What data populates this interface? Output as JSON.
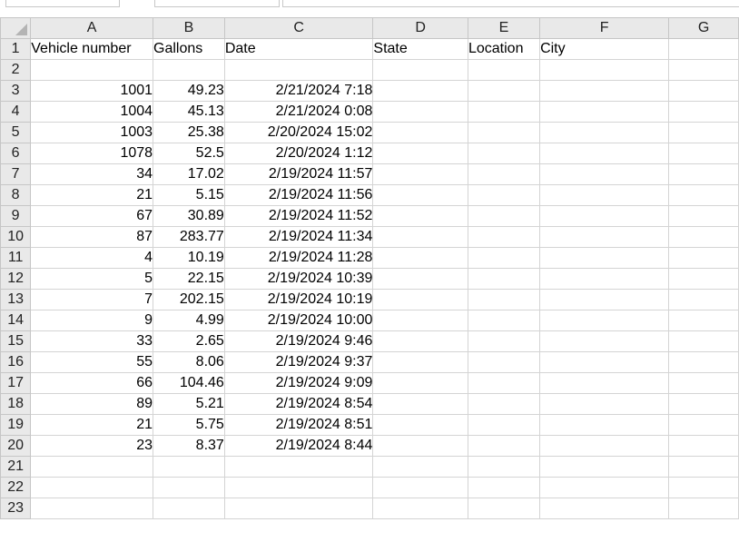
{
  "columns": [
    "A",
    "B",
    "C",
    "D",
    "E",
    "F",
    "G"
  ],
  "header_row": [
    "Vehicle number",
    "Gallons",
    "Date",
    "State",
    "Location",
    "City",
    ""
  ],
  "rows": [
    {
      "vehicle": "",
      "gallons": "",
      "date": ""
    },
    {
      "vehicle": "1001",
      "gallons": "49.23",
      "date": "2/21/2024 7:18"
    },
    {
      "vehicle": "1004",
      "gallons": "45.13",
      "date": "2/21/2024 0:08"
    },
    {
      "vehicle": "1003",
      "gallons": "25.38",
      "date": "2/20/2024 15:02"
    },
    {
      "vehicle": "1078",
      "gallons": "52.5",
      "date": "2/20/2024 1:12"
    },
    {
      "vehicle": "34",
      "gallons": "17.02",
      "date": "2/19/2024 11:57"
    },
    {
      "vehicle": "21",
      "gallons": "5.15",
      "date": "2/19/2024 11:56"
    },
    {
      "vehicle": "67",
      "gallons": "30.89",
      "date": "2/19/2024 11:52"
    },
    {
      "vehicle": "87",
      "gallons": "283.77",
      "date": "2/19/2024 11:34"
    },
    {
      "vehicle": "4",
      "gallons": "10.19",
      "date": "2/19/2024 11:28"
    },
    {
      "vehicle": "5",
      "gallons": "22.15",
      "date": "2/19/2024 10:39"
    },
    {
      "vehicle": "7",
      "gallons": "202.15",
      "date": "2/19/2024 10:19"
    },
    {
      "vehicle": "9",
      "gallons": "4.99",
      "date": "2/19/2024 10:00"
    },
    {
      "vehicle": "33",
      "gallons": "2.65",
      "date": "2/19/2024 9:46"
    },
    {
      "vehicle": "55",
      "gallons": "8.06",
      "date": "2/19/2024 9:37"
    },
    {
      "vehicle": "66",
      "gallons": "104.46",
      "date": "2/19/2024 9:09"
    },
    {
      "vehicle": "89",
      "gallons": "5.21",
      "date": "2/19/2024 8:54"
    },
    {
      "vehicle": "21",
      "gallons": "5.75",
      "date": "2/19/2024 8:51"
    },
    {
      "vehicle": "23",
      "gallons": "8.37",
      "date": "2/19/2024 8:44"
    },
    {
      "vehicle": "",
      "gallons": "",
      "date": ""
    },
    {
      "vehicle": "",
      "gallons": "",
      "date": ""
    },
    {
      "vehicle": "",
      "gallons": "",
      "date": ""
    }
  ],
  "row_numbers": [
    "1",
    "2",
    "3",
    "4",
    "5",
    "6",
    "7",
    "8",
    "9",
    "10",
    "11",
    "12",
    "13",
    "14",
    "15",
    "16",
    "17",
    "18",
    "19",
    "20",
    "21",
    "22",
    "23"
  ]
}
